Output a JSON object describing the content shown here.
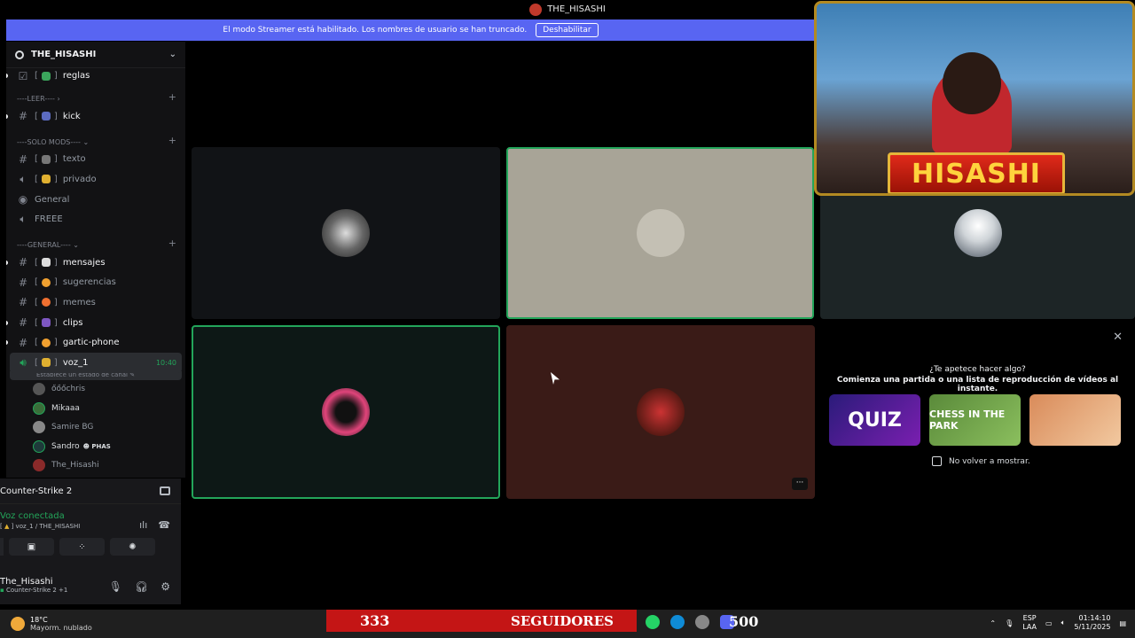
{
  "window": {
    "title": "THE_HISASHI"
  },
  "banner": {
    "text": "El modo Streamer está habilitado. Los nombres de usuario se han truncado.",
    "button": "Deshabilitar"
  },
  "server": {
    "name": "THE_HISASHI"
  },
  "channels": {
    "reglas": "reglas",
    "cat_leer": "----LEER----",
    "kick": "kick",
    "cat_mods": "----SOLO MODS----",
    "texto": "texto",
    "privado": "privado",
    "general": "General",
    "freee": "FREEE",
    "cat_general": "----GENERAL----",
    "mensajes": "mensajes",
    "sugerencias": "sugerencias",
    "memes": "memes",
    "clips": "clips",
    "gartic": "gartic-phone",
    "voz": "voz_1",
    "voz_time": "10:40",
    "voz_status": "Establece un estado de canal"
  },
  "voice_users": [
    {
      "name": "őőőchris"
    },
    {
      "name": "Mikaaa"
    },
    {
      "name": "Samire BG"
    },
    {
      "name": "Sandro",
      "tag": "PHAS"
    },
    {
      "name": "The_Hisashi"
    }
  ],
  "panel": {
    "activity": "Counter-Strike 2",
    "voice_connected": "Voz conectada",
    "voice_sub": "voz_1 / THE_HISASHI",
    "user_name": "The_Hisashi",
    "user_status": "Counter-Strike 2 +1"
  },
  "promo": {
    "question": "¿Te apetece hacer algo?",
    "desc": "Comienza una partida o una lista de reproducción de vídeos al instante.",
    "games": [
      "QUIZ",
      "CHESS IN THE PARK",
      ""
    ],
    "checkbox": "No volver a mostrar."
  },
  "cam": {
    "name": "HISASHI"
  },
  "taskbar": {
    "temp": "18°C",
    "weather": "Mayorm. nublado",
    "followers_count": "333",
    "followers_label": "SEGUIDORES",
    "counter": "500",
    "lang1": "ESP",
    "lang2": "LAA",
    "time": "01:14:10",
    "date": "5/11/2025"
  },
  "colors": {
    "accent": "#5865f2",
    "speaking": "#23a55a",
    "stream_red": "#c41515"
  }
}
